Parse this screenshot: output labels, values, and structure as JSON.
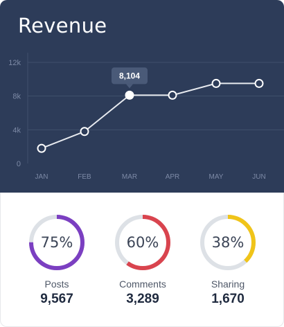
{
  "header": {
    "title": "Revenue"
  },
  "chart_data": {
    "type": "line",
    "categories": [
      "JAN",
      "FEB",
      "MAR",
      "APR",
      "MAY",
      "JUN"
    ],
    "values": [
      1800,
      3800,
      8104,
      8104,
      9500,
      9500
    ],
    "ylim": [
      0,
      12000
    ],
    "yticks": [
      0,
      4000,
      8000,
      12000
    ],
    "ytick_labels": [
      "0",
      "4k",
      "8k",
      "12k"
    ],
    "grid": true,
    "highlight": {
      "index": 2,
      "label": "8,104"
    }
  },
  "stats": [
    {
      "percent_label": "75%",
      "percent": 75,
      "label": "Posts",
      "value": "9,567",
      "color": "#7b3fc1"
    },
    {
      "percent_label": "60%",
      "percent": 60,
      "label": "Comments",
      "value": "3,289",
      "color": "#d9444e"
    },
    {
      "percent_label": "38%",
      "percent": 38,
      "label": "Sharing",
      "value": "1,670",
      "color": "#f0c419"
    }
  ],
  "colors": {
    "header_bg": "#2d3c59",
    "ring_track": "#dde1e6",
    "line": "#e8ebf0",
    "tooltip_bg": "#4a5a78"
  }
}
